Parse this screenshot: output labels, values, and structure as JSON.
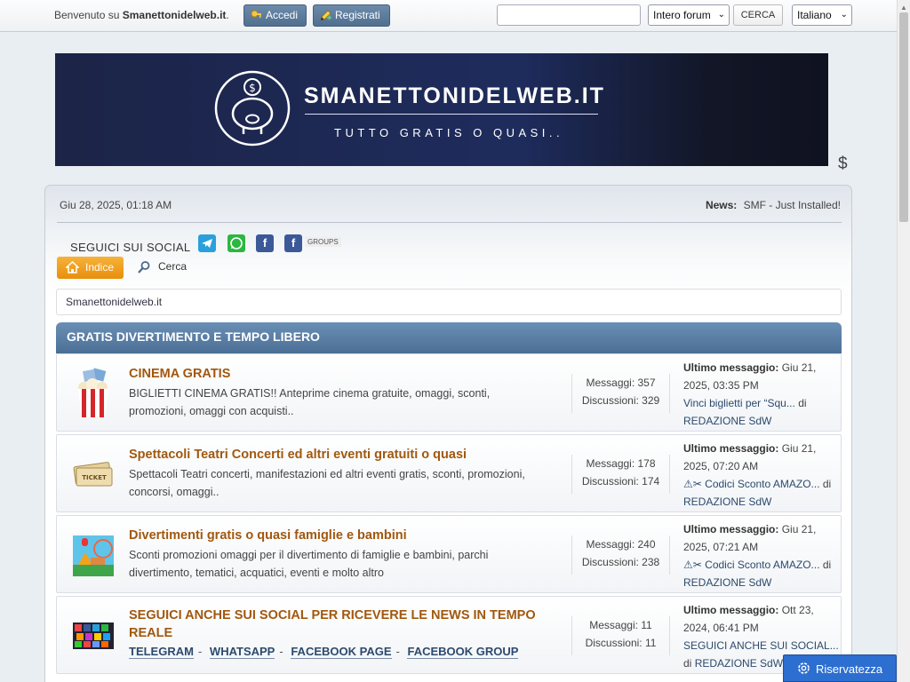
{
  "topbar": {
    "welcome_prefix": "Benvenuto su",
    "site_name": "Smanettonidelweb.it",
    "welcome_suffix": ".",
    "login_label": "Accedi",
    "register_label": "Registrati",
    "search_value": "",
    "scope_select": "Intero forum",
    "search_button": "CERCA",
    "language_select": "Italiano"
  },
  "banner": {
    "title": "SMANETTONIDELWEB.IT",
    "subtitle": "TUTTO GRATIS O QUASI.."
  },
  "extra_icon": "$",
  "info": {
    "date": "Giu 28, 2025, 01:18 AM",
    "news_label": "News:",
    "news_text": "SMF - Just Installed!"
  },
  "social": {
    "label": "SEGUICI SUI SOCIAL",
    "groups_text": "GROUPS",
    "icons": [
      "telegram-icon",
      "whatsapp-icon",
      "facebook-icon",
      "facebook-groups-icon"
    ]
  },
  "menu": {
    "home": "Indice",
    "search": "Cerca"
  },
  "breadcrumb": "Smanettonidelweb.it",
  "category": {
    "title": "GRATIS DIVERTIMENTO E TEMPO LIBERO",
    "boards": [
      {
        "title": "CINEMA GRATIS",
        "description": "BIGLIETTI CINEMA GRATIS!! Anteprime cinema gratuite, omaggi, sconti, promozioni, omaggi con acquisti..",
        "posts": "Messaggi: 357",
        "topics": "Discussioni: 329",
        "last_label": "Ultimo messaggio:",
        "last_date": "Giu 21, 2025, 03:35 PM",
        "last_topic": "Vinci biglietti per “Squ...",
        "by": "di",
        "last_author": "REDAZIONE SdW"
      },
      {
        "title": "Spettacoli Teatri Concerti ed altri eventi gratuiti o quasi",
        "description": "Spettacoli Teatri concerti, manifestazioni ed altri eventi gratis, sconti, promozioni, concorsi, omaggi..",
        "posts": "Messaggi: 178",
        "topics": "Discussioni: 174",
        "last_label": "Ultimo messaggio:",
        "last_date": "Giu 21, 2025, 07:20 AM",
        "last_topic": "⚠✂ Codici Sconto AMAZO...",
        "by": "di",
        "last_author": "REDAZIONE SdW"
      },
      {
        "title": "Divertimenti gratis o quasi famiglie e bambini",
        "description": "Sconti  promozioni omaggi per il divertimento  di famiglie e bambini, parchi divertimento, tematici,  acquatici, eventi e molto altro",
        "posts": "Messaggi: 240",
        "topics": "Discussioni: 238",
        "last_label": "Ultimo messaggio:",
        "last_date": "Giu 21, 2025, 07:21 AM",
        "last_topic": "⚠✂ Codici Sconto AMAZO...",
        "by": "di",
        "last_author": "REDAZIONE SdW"
      },
      {
        "title": "SEGUICI ANCHE SUI SOCIAL PER RICEVERE LE NEWS IN TEMPO REALE",
        "links": [
          "TELEGRAM",
          "WHATSAPP",
          "FACEBOOK PAGE",
          "FACEBOOK GROUP"
        ],
        "posts": "Messaggi: 11",
        "topics": "Discussioni: 11",
        "last_label": "Ultimo messaggio:",
        "last_date": "Ott 23, 2024, 06:41 PM",
        "last_topic": "SEGUICI ANCHE SUI SOCIAL...",
        "by": "di",
        "last_author": "REDAZIONE SdW"
      }
    ]
  },
  "privacy_button": "Riservatezza"
}
